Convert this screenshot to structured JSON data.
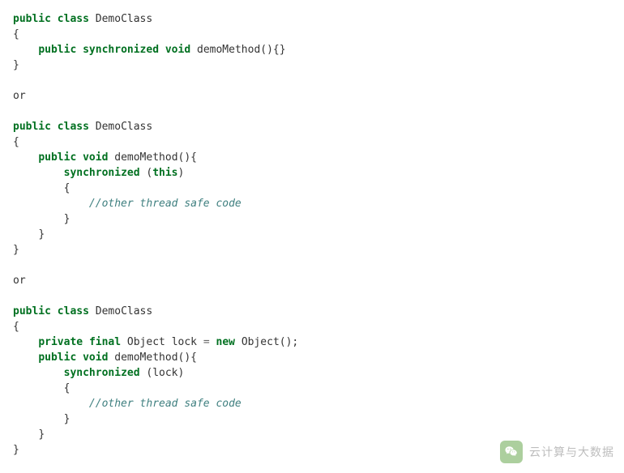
{
  "code": {
    "kw_public": "public",
    "kw_class": "class",
    "cls_demo": "DemoClass",
    "kw_synchronized": "synchronized",
    "kw_void": "void",
    "method_name": "demoMethod",
    "kw_this": "this",
    "comment_threadsafe": "//other thread safe code",
    "kw_private": "private",
    "kw_final": "final",
    "type_object": "Object",
    "var_lock": "lock",
    "kw_new": "new",
    "separator_or": "or",
    "brace_open": "{",
    "brace_close": "}",
    "paren_open": "(",
    "paren_close": ")",
    "empty_parens_braces": "(){}",
    "parens_brace_open": "(){",
    "op_eq": "=",
    "semi": ";",
    "obj_ctor_suffix": "();"
  },
  "watermark": {
    "text": "云计算与大数据"
  }
}
